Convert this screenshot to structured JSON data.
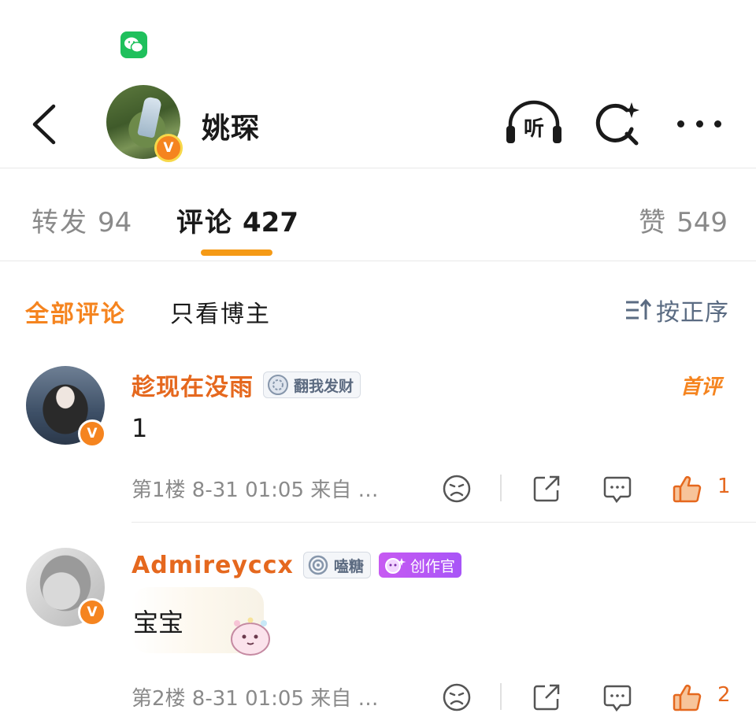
{
  "header": {
    "name": "姚琛",
    "verified_mark": "V",
    "icons": {
      "back": "chevron-left-icon",
      "listen": "headphones-icon",
      "listen_glyph": "听",
      "search": "sparkle-search-icon",
      "more": "more-horizontal-icon"
    }
  },
  "tabs": {
    "repost": {
      "label": "转发",
      "count": "94"
    },
    "comment": {
      "label": "评论",
      "count": "427"
    },
    "like": {
      "label": "赞",
      "count": "549"
    }
  },
  "filter": {
    "all_label": "全部评论",
    "owner_label": "只看博主",
    "sort_label": "按正序"
  },
  "comments": [
    {
      "username": "趁现在没雨",
      "medal": "翻我发财",
      "tag": "首评",
      "text": "1",
      "meta": "第1楼 8-31 01:05 来自 …",
      "likes": "1",
      "verified_mark": "V"
    },
    {
      "username": "Admireyccx",
      "medal": "嗑糖",
      "creator_badge": "创作官",
      "text": "宝宝",
      "meta": "第2楼 8-31 01:05 来自 …",
      "likes": "2",
      "verified_mark": "V"
    }
  ],
  "colors": {
    "accent_orange": "#f5841f",
    "username_orange": "#e5681e",
    "tab_underline": "#f59a16",
    "wechat_green": "#1fc05c",
    "creator_purple": "#a855f7",
    "sort_blue_gray": "#5a6b82"
  }
}
